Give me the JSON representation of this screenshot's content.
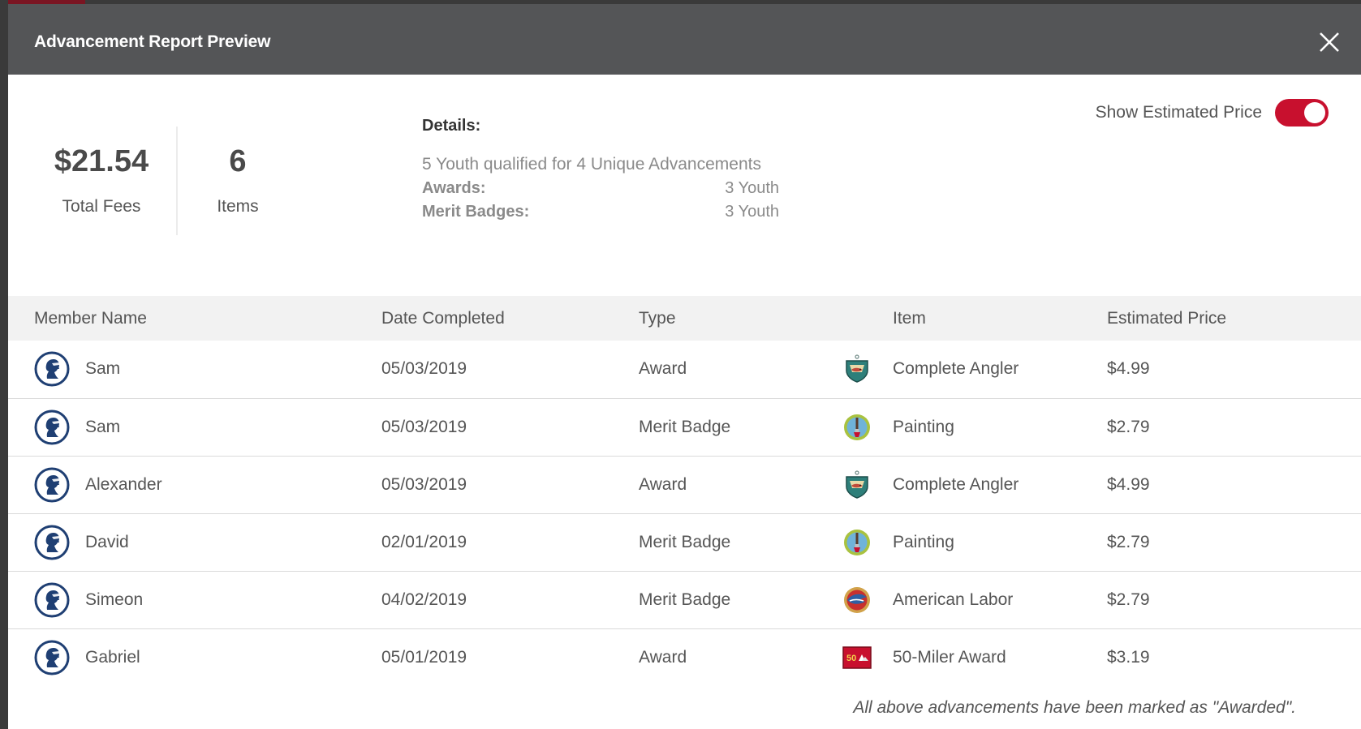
{
  "modal": {
    "title": "Advancement Report Preview"
  },
  "summary": {
    "total_fees": "$21.54",
    "total_fees_label": "Total Fees",
    "items_count": "6",
    "items_label": "Items"
  },
  "details": {
    "title": "Details:",
    "summary": "5 Youth qualified for 4 Unique Advancements",
    "awards_label": "Awards:",
    "awards_value": "3 Youth",
    "merit_label": "Merit Badges:",
    "merit_value": "3 Youth"
  },
  "toggle": {
    "label": "Show Estimated Price",
    "on": true
  },
  "table": {
    "headers": [
      "Member Name",
      "Date Completed",
      "Type",
      "Item",
      "Estimated Price"
    ],
    "rows": [
      {
        "name": "Sam",
        "date": "05/03/2019",
        "type": "Award",
        "item": "Complete Angler",
        "icon": "complete-angler-badge-icon",
        "price": "$4.99"
      },
      {
        "name": "Sam",
        "date": "05/03/2019",
        "type": "Merit Badge",
        "item": "Painting",
        "icon": "painting-badge-icon",
        "price": "$2.79"
      },
      {
        "name": "Alexander",
        "date": "05/03/2019",
        "type": "Award",
        "item": "Complete Angler",
        "icon": "complete-angler-badge-icon",
        "price": "$4.99"
      },
      {
        "name": "David",
        "date": "02/01/2019",
        "type": "Merit Badge",
        "item": "Painting",
        "icon": "painting-badge-icon",
        "price": "$2.79"
      },
      {
        "name": "Simeon",
        "date": "04/02/2019",
        "type": "Merit Badge",
        "item": "American Labor",
        "icon": "american-labor-badge-icon",
        "price": "$2.79"
      },
      {
        "name": "Gabriel",
        "date": "05/01/2019",
        "type": "Award",
        "item": "50-Miler Award",
        "icon": "fifty-miler-award-icon",
        "price": "$3.19"
      }
    ]
  },
  "footnote": "All above advancements have been marked as \"Awarded\".",
  "colors": {
    "header_bg": "#545557",
    "toggle_on": "#c8102e",
    "avatar_blue": "#1f3f73"
  }
}
